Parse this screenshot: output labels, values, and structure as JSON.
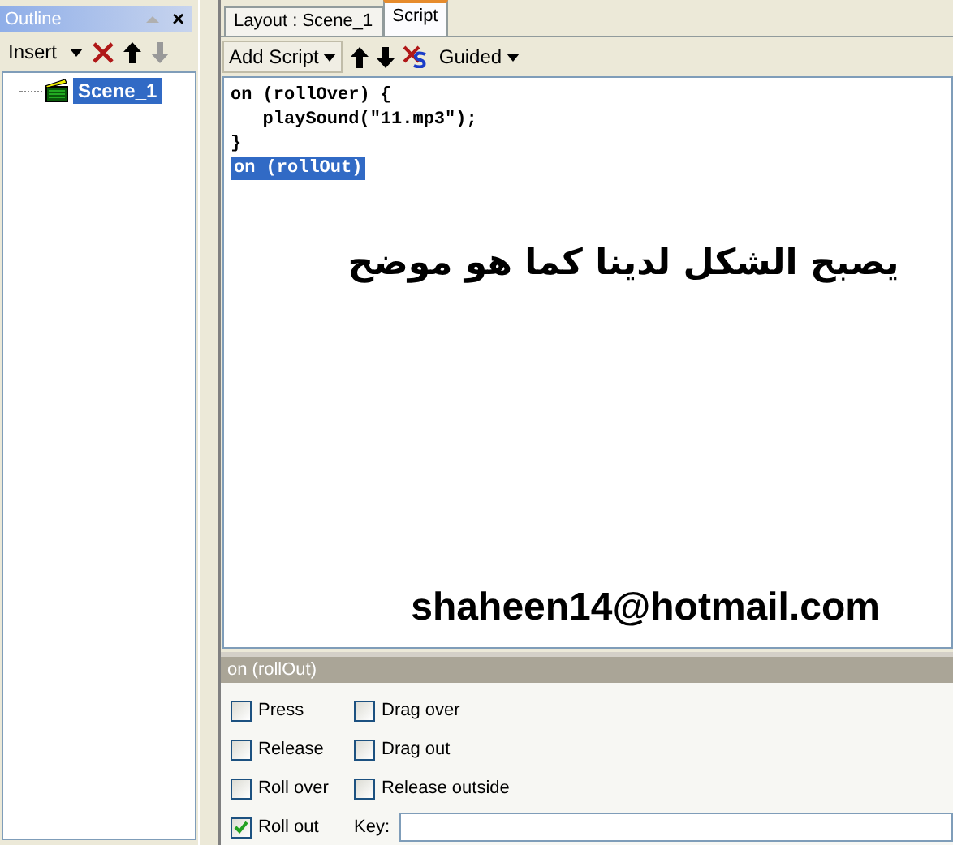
{
  "outline": {
    "title": "Outline",
    "close": "×",
    "toolbar": {
      "insert": "Insert"
    },
    "tree": [
      {
        "label": "Scene_1",
        "selected": true
      }
    ]
  },
  "tabs": [
    {
      "label": "Layout : Scene_1",
      "selected": false
    },
    {
      "label": "Script",
      "selected": true
    }
  ],
  "script_toolbar": {
    "add_script": "Add Script",
    "guided": "Guided"
  },
  "code": [
    {
      "text": "on (rollOver) {",
      "selected": false
    },
    {
      "text": "   playSound(\"11.mp3\");",
      "selected": false
    },
    {
      "text": "}",
      "selected": false
    },
    {
      "text": "on (rollOut)",
      "selected": true
    }
  ],
  "annotations": {
    "caption": "يصبح الشكل لدينا كما هو موضح",
    "email": "shaheen14@hotmail.com"
  },
  "events": {
    "title": "on (rollOut)",
    "options": [
      {
        "label": "Press",
        "checked": false
      },
      {
        "label": "Drag over",
        "checked": false
      },
      {
        "label": "Release",
        "checked": false
      },
      {
        "label": "Drag out",
        "checked": false
      },
      {
        "label": "Roll over",
        "checked": false
      },
      {
        "label": "Release outside",
        "checked": false
      },
      {
        "label": "Roll out",
        "checked": true
      }
    ],
    "key_label": "Key:"
  }
}
